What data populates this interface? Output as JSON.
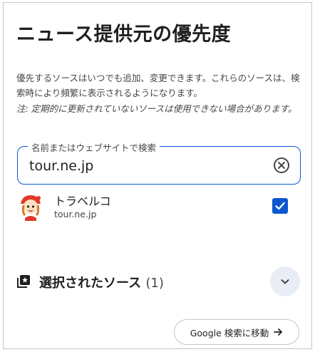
{
  "header": {
    "title": "ニュース提供元の優先度"
  },
  "description": "優先するソースはいつでも追加、変更できます。これらのソースは、検索時により頻繁に表示されるようになります。",
  "note": "注: 定期的に更新されていないソースは使用できない場合があります。",
  "search": {
    "label": "名前またはウェブサイトで検索",
    "value": "tour.ne.jp",
    "clear_icon": "close-circle-icon"
  },
  "results": [
    {
      "name": "トラベルコ",
      "domain": "tour.ne.jp",
      "checked": true,
      "avatar_icon": "mascot-avatar"
    }
  ],
  "selected": {
    "label": "選択されたソース",
    "count": "(1)",
    "icon": "selected-sources-icon",
    "expand_icon": "chevron-down-icon"
  },
  "footer": {
    "google_button": "Google 検索に移動",
    "arrow_icon": "arrow-right-icon"
  },
  "colors": {
    "accent": "#0b57d0",
    "text": "#1f1f1f",
    "muted": "#444746",
    "border": "#c4c7c5",
    "chip_bg": "#e9eef6"
  }
}
